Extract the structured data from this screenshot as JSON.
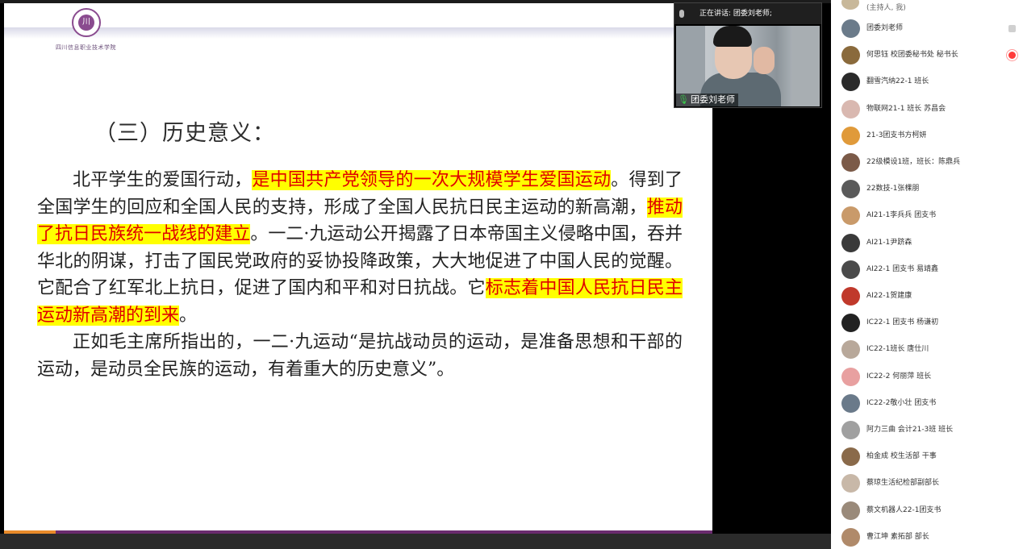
{
  "slide": {
    "logo_name": "四川信息职业技术学院",
    "logo_glyph": "川",
    "title": "（三）历史意义：",
    "paragraph1": [
      {
        "text": "北平学生的爱国行动，",
        "hl": false
      },
      {
        "text": "是中国共产党领导的一次大规模学生爱国运动",
        "hl": true
      },
      {
        "text": "。得到了全国学生的回应和全国人民的支持，形成了全国人民抗日民主运动的新高潮，",
        "hl": false
      },
      {
        "text": "推动了抗日民族统一战线的建立",
        "hl": true
      },
      {
        "text": "。一二·九运动公开揭露了日本帝国主义侵略中国，吞并华北的阴谋，打击了国民党政府的妥协投降政策，大大地促进了中国人民的觉醒。它配合了红军北上抗日，促进了国内和平和对日抗战。它",
        "hl": false
      },
      {
        "text": "标志着中国人民抗日民主运动新高潮的到来",
        "hl": true
      },
      {
        "text": "。",
        "hl": false
      }
    ],
    "paragraph2": "正如毛主席所指出的，一二·九运动“是抗战动员的运动，是准备思想和干部的运动，是动员全民族的运动，有着重大的历史意义”。"
  },
  "speaker": {
    "header": "正在讲话: 团委刘老师;",
    "name": "团委刘老师"
  },
  "participants": {
    "first_name": "(主持人, 我)",
    "items": [
      {
        "name": "团委刘老师",
        "status": "mic",
        "color": "#6b7b8a"
      },
      {
        "name": "何思钰  校团委秘书处  秘书长",
        "status": "rec",
        "color": "#8a6a3c"
      },
      {
        "name": "翻雪汽纳22-1 班长",
        "status": "",
        "color": "#2a2a2a"
      },
      {
        "name": "物联网21-1 班长 苏昌会",
        "status": "",
        "color": "#d9b8b0"
      },
      {
        "name": "21-3团支书方柯妍",
        "status": "",
        "color": "#e09a3a"
      },
      {
        "name": "22级模设1班，班长：陈鼎兵",
        "status": "",
        "color": "#7b5a48"
      },
      {
        "name": "22数技-1张棵朋",
        "status": "",
        "color": "#5a5a5a"
      },
      {
        "name": "AI21-1李兵兵 团支书",
        "status": "",
        "color": "#c99a6a"
      },
      {
        "name": "AI21-1尹跻森",
        "status": "",
        "color": "#3a3a3a"
      },
      {
        "name": "AI22-1  团支书  易靖鑫",
        "status": "",
        "color": "#4a4a4a"
      },
      {
        "name": "AI22-1贺建康",
        "status": "",
        "color": "#c0392b"
      },
      {
        "name": "IC22-1 团支书  杨谦初",
        "status": "",
        "color": "#222222"
      },
      {
        "name": "IC22-1班长 唐仕川",
        "status": "",
        "color": "#b8a89a"
      },
      {
        "name": "IC22-2 何丽萍 班长",
        "status": "",
        "color": "#e8a0a0"
      },
      {
        "name": "IC22-2敬小壮  团支书",
        "status": "",
        "color": "#6a7a8a"
      },
      {
        "name": "阿力三曲  会计21-3班  班长",
        "status": "",
        "color": "#a0a0a0"
      },
      {
        "name": "柏金成 校生活部  干事",
        "status": "",
        "color": "#8a6a4a"
      },
      {
        "name": "蔡琼生活纪检部副部长",
        "status": "",
        "color": "#c8b8a8"
      },
      {
        "name": "蔡文机器人22-1团支书",
        "status": "",
        "color": "#9a8a7a"
      },
      {
        "name": "曹江坤 素拓部 部长",
        "status": "",
        "color": "#b08a6a"
      }
    ]
  }
}
